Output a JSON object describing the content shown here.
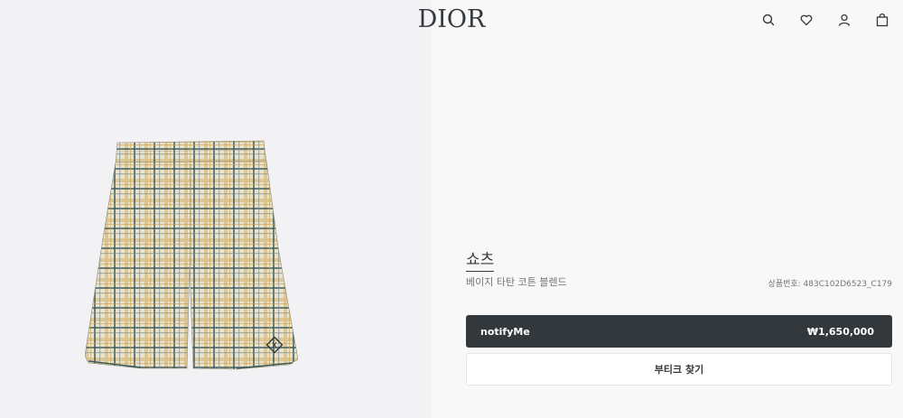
{
  "header": {
    "logo": "DIOR",
    "icons": [
      "search-icon",
      "heart-icon",
      "user-icon",
      "shopping-bag-icon"
    ]
  },
  "product": {
    "title": "쇼츠",
    "subtitle": "베이지 타탄 코튼 블렌드",
    "reference": "상품번호: 483C102D6523_C179",
    "image_alt": "beige tartan shorts"
  },
  "actions": {
    "notify_label": "notifyMe",
    "price": "₩1,650,000",
    "boutique_label": "부티크 찾기"
  },
  "colors": {
    "dark": "#33383c",
    "left_bg": "#f2f2f4",
    "right_bg": "#f8f8f8"
  }
}
